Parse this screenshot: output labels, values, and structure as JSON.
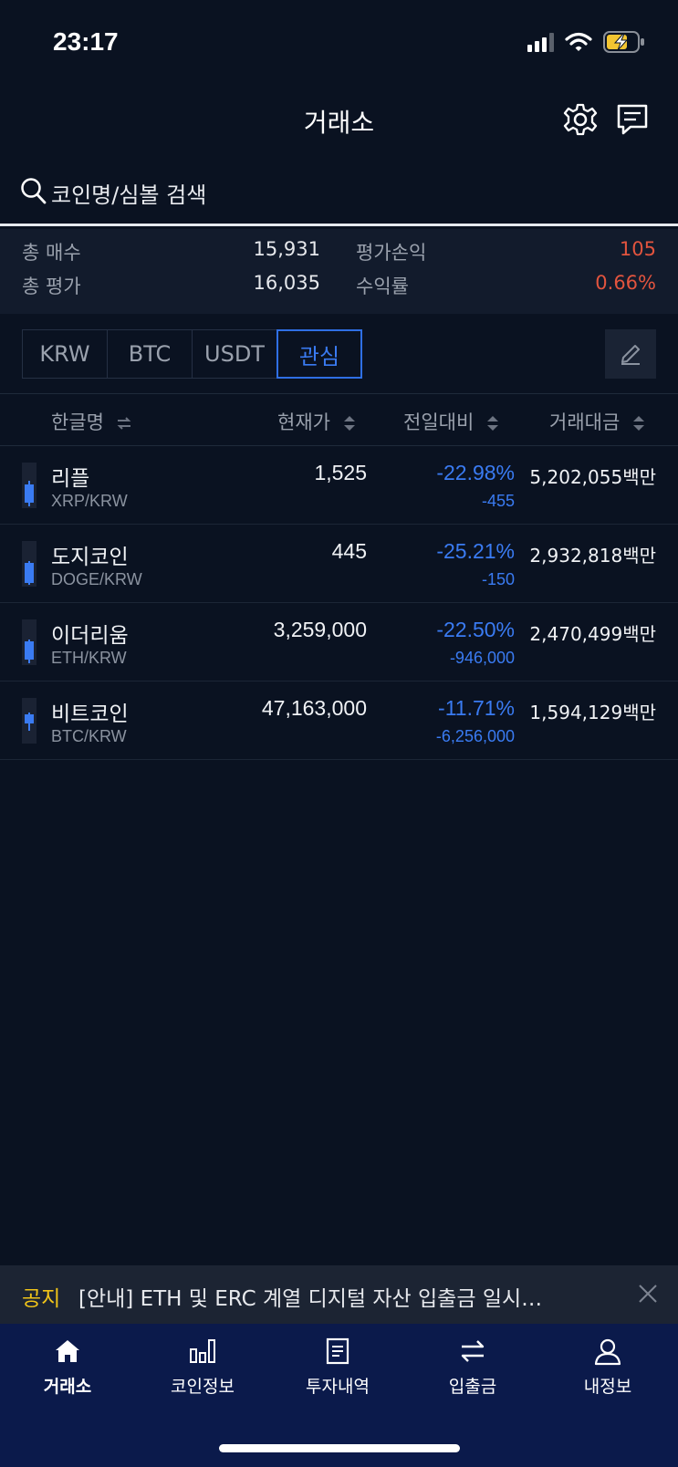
{
  "status_bar": {
    "time": "23:17"
  },
  "header": {
    "title": "거래소",
    "settings_icon": "gear-icon",
    "message_icon": "chat-icon"
  },
  "search": {
    "placeholder": "코인명/심볼 검색"
  },
  "summary": {
    "total_buy_label": "총 매수",
    "total_buy": "15,931",
    "total_eval_label": "총 평가",
    "total_eval": "16,035",
    "pnl_label": "평가손익",
    "pnl": "105",
    "return_label": "수익률",
    "return": "0.66%"
  },
  "tabs": [
    {
      "label": "KRW",
      "active": false
    },
    {
      "label": "BTC",
      "active": false
    },
    {
      "label": "USDT",
      "active": false
    },
    {
      "label": "관심",
      "active": true
    }
  ],
  "columns": {
    "name": "한글명",
    "price": "현재가",
    "change": "전일대비",
    "volume": "거래대금"
  },
  "coins": [
    {
      "name": "리플",
      "pair": "XRP/KRW",
      "price": "1,525",
      "change_pct": "-22.98%",
      "change_abs": "-455",
      "volume": "5,202,055백만"
    },
    {
      "name": "도지코인",
      "pair": "DOGE/KRW",
      "price": "445",
      "change_pct": "-25.21%",
      "change_abs": "-150",
      "volume": "2,932,818백만"
    },
    {
      "name": "이더리움",
      "pair": "ETH/KRW",
      "price": "3,259,000",
      "change_pct": "-22.50%",
      "change_abs": "-946,000",
      "volume": "2,470,499백만"
    },
    {
      "name": "비트코인",
      "pair": "BTC/KRW",
      "price": "47,163,000",
      "change_pct": "-11.71%",
      "change_abs": "-6,256,000",
      "volume": "1,594,129백만"
    }
  ],
  "notice": {
    "tag": "공지",
    "text": "[안내] ETH 및 ERC 계열 디지털 자산 입출금 일시…"
  },
  "bottom_nav": [
    {
      "label": "거래소",
      "icon": "home-icon",
      "active": true
    },
    {
      "label": "코인정보",
      "icon": "bar-chart-icon",
      "active": false
    },
    {
      "label": "투자내역",
      "icon": "document-icon",
      "active": false
    },
    {
      "label": "입출금",
      "icon": "transfer-arrows-icon",
      "active": false
    },
    {
      "label": "내정보",
      "icon": "user-icon",
      "active": false
    }
  ],
  "colors": {
    "background": "#0a1221",
    "accent_blue": "#3a7bf2",
    "negative_red": "#e2543e",
    "notice_yellow": "#f0c419",
    "nav_bg": "#0b1a4b"
  }
}
